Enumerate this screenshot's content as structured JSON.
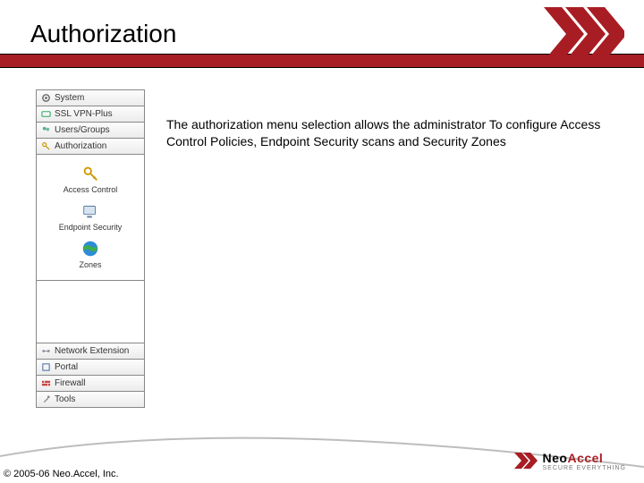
{
  "header": {
    "title": "Authorization"
  },
  "sidebar": {
    "top": [
      {
        "label": "System"
      },
      {
        "label": "SSL VPN-Plus"
      },
      {
        "label": "Users/Groups"
      },
      {
        "label": "Authorization"
      }
    ],
    "auth_items": [
      {
        "label": "Access Control"
      },
      {
        "label": "Endpoint Security"
      },
      {
        "label": "Zones"
      }
    ],
    "bottom": [
      {
        "label": "Network Extension"
      },
      {
        "label": "Portal"
      },
      {
        "label": "Firewall"
      },
      {
        "label": "Tools"
      }
    ]
  },
  "body": {
    "text": "The authorization menu selection allows the administrator To configure Access Control Policies, Endpoint Security scans and Security Zones"
  },
  "footer": {
    "copyright": "© 2005-06 Neo.Accel, Inc.",
    "logo_neo": "Neo",
    "logo_accel": "Accel",
    "logo_tag": "SECURE EVERYTHING"
  }
}
